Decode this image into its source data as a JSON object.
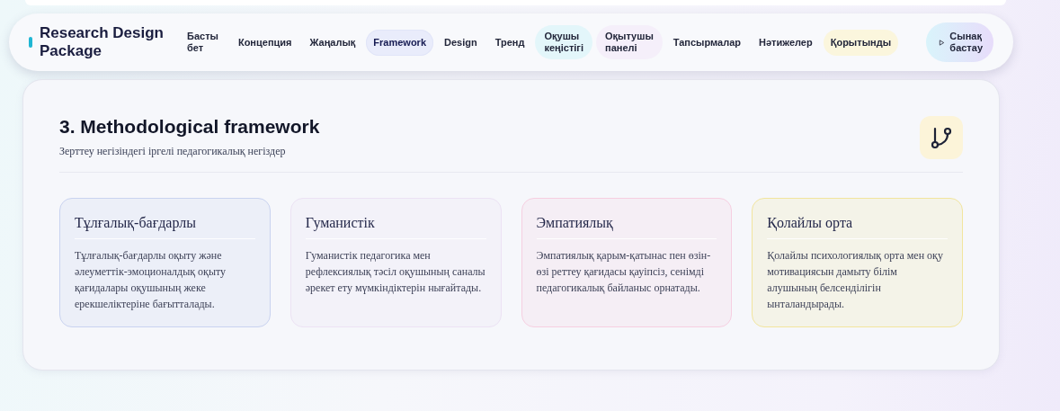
{
  "brand": {
    "title": "Research Design Package"
  },
  "nav": [
    {
      "label": "Басты бет",
      "wrap": true,
      "selected": false
    },
    {
      "label": "Концепция",
      "wrap": false,
      "selected": false
    },
    {
      "label": "Жаңалық",
      "wrap": false,
      "selected": false
    },
    {
      "label": "Framework",
      "wrap": false,
      "selected": true
    },
    {
      "label": "Design",
      "wrap": false,
      "selected": false
    },
    {
      "label": "Тренд",
      "wrap": false,
      "selected": false
    },
    {
      "label": "Оқушы кеңістігі",
      "wrap": true,
      "selected": false,
      "color": "#e3f6fa"
    },
    {
      "label": "Оқытушы панелі",
      "wrap": true,
      "selected": false,
      "color": "#f5effa"
    },
    {
      "label": "Тапсырмалар",
      "wrap": false,
      "selected": false
    },
    {
      "label": "Нәтижелер",
      "wrap": false,
      "selected": false
    },
    {
      "label": "Қорытынды",
      "wrap": false,
      "selected": false,
      "color": "#fbf6dd"
    }
  ],
  "start_button": {
    "label": "Сынақ бастау"
  },
  "section": {
    "title": "3. Methodological framework",
    "subtitle": "Зерттеу негізіндегі іргелі педагогикалық негіздер",
    "cards": [
      {
        "title": "Тұлғалық-бағдарлы",
        "text": "Тұлғалық-бағдарлы оқыту және әлеуметтік-эмоционалдық оқыту қағидалары оқушының жеке ерекшеліктеріне бағытталады.",
        "color": "#c9d3f0"
      },
      {
        "title": "Гуманистік",
        "text": "Гуманистік педагогика мен рефлексиялық тәсіл оқушының саналы әрекет ету мүмкіндіктерін нығайтады.",
        "color": "#ece2f4"
      },
      {
        "title": "Эмпатиялық",
        "text": "Эмпатиялық қарым-қатынас пен өзін-өзі реттеу қағидасы қауіпсіз, сенімді педагогикалық байланыс орнатады.",
        "color": "#f6cfe1"
      },
      {
        "title": "Қолайлы орта",
        "text": "Қолайлы психологиялық орта мен оқу мотивациясын дамыту білім алушының белсенділігін ынталандырады.",
        "color": "#f2e59e"
      }
    ]
  }
}
